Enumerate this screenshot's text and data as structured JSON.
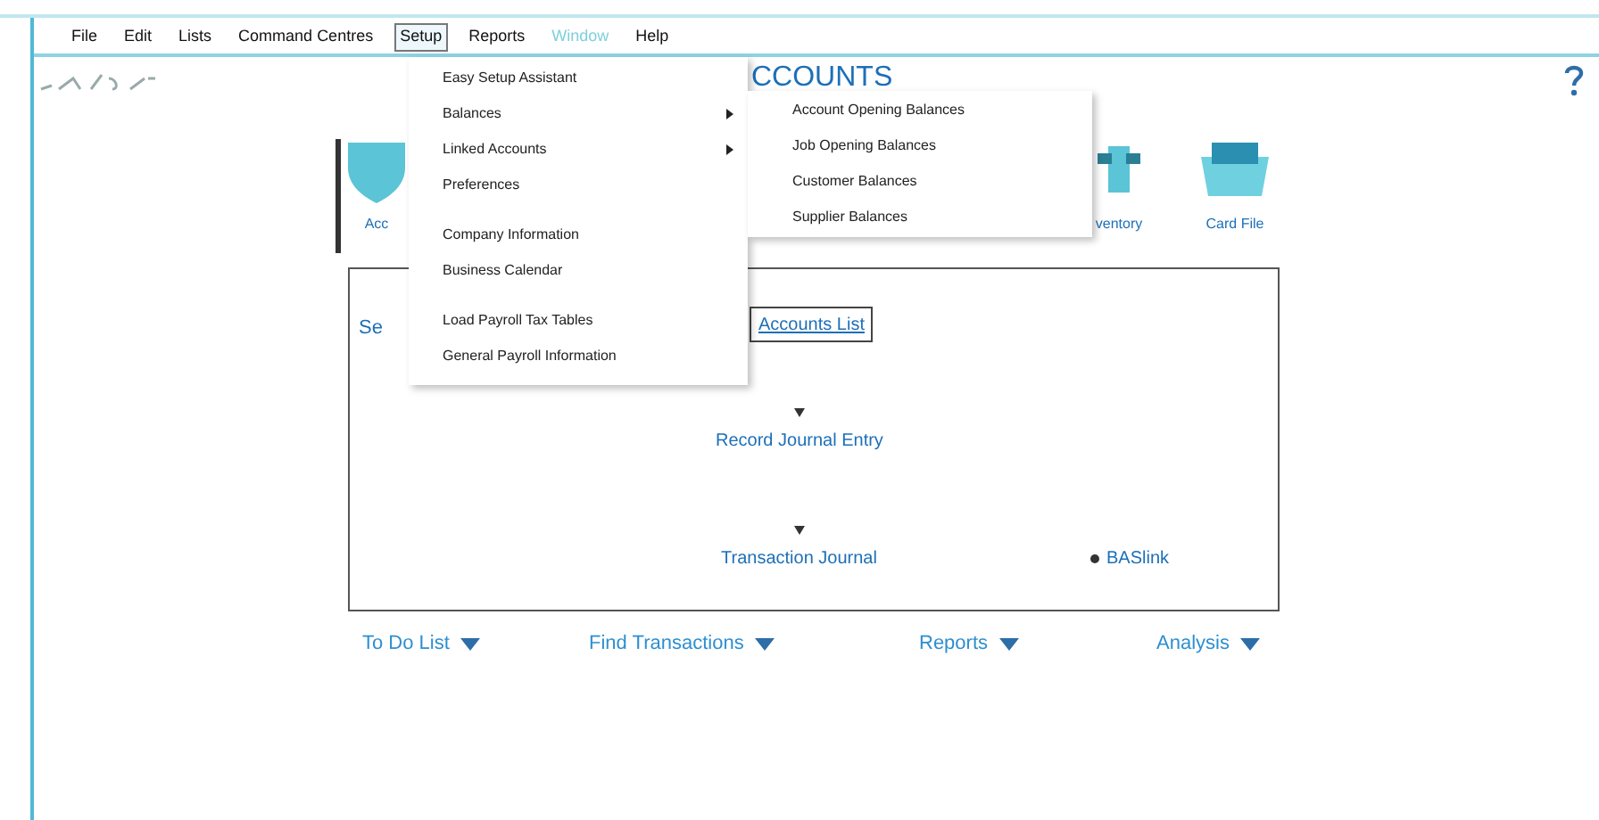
{
  "menu_bar": [
    {
      "label": "File",
      "selected": false,
      "disabled": false
    },
    {
      "label": "Edit",
      "selected": false,
      "disabled": false
    },
    {
      "label": "Lists",
      "selected": false,
      "disabled": false
    },
    {
      "label": "Command Centres",
      "selected": false,
      "disabled": false
    },
    {
      "label": "Setup",
      "selected": true,
      "disabled": false
    },
    {
      "label": "Reports",
      "selected": false,
      "disabled": false
    },
    {
      "label": "Window",
      "selected": false,
      "disabled": true
    },
    {
      "label": "Help",
      "selected": false,
      "disabled": false
    }
  ],
  "setup_menu": {
    "groups": [
      [
        {
          "label": "Easy Setup Assistant",
          "submenu": false
        },
        {
          "label": "Balances",
          "submenu": true
        },
        {
          "label": "Linked Accounts",
          "submenu": true
        },
        {
          "label": "Preferences",
          "submenu": false
        }
      ],
      [
        {
          "label": "Company Information",
          "submenu": false
        },
        {
          "label": "Business Calendar",
          "submenu": false
        }
      ],
      [
        {
          "label": "Load Payroll Tax Tables",
          "submenu": false
        },
        {
          "label": "General Payroll Information",
          "submenu": false
        }
      ]
    ]
  },
  "balances_submenu": {
    "items": [
      "Account Opening Balances",
      "Job Opening Balances",
      "Customer Balances",
      "Supplier Balances"
    ]
  },
  "command_centre": {
    "title": "CCOUNTS",
    "icons": [
      {
        "label": "Acc",
        "kind": "accounts"
      },
      {
        "label": "ventory",
        "kind": "inventory"
      },
      {
        "label": "Card File",
        "kind": "cardfile"
      }
    ],
    "section_label": "Se",
    "accounts_list_button": "Accounts List",
    "flow": [
      {
        "label": "Record Journal Entry",
        "kind": "step"
      },
      {
        "label": "Transaction Journal",
        "kind": "step"
      },
      {
        "label": "BASlink",
        "kind": "side"
      }
    ],
    "bottom_links": [
      "To Do List",
      "Find Transactions",
      "Reports",
      "Analysis"
    ]
  }
}
